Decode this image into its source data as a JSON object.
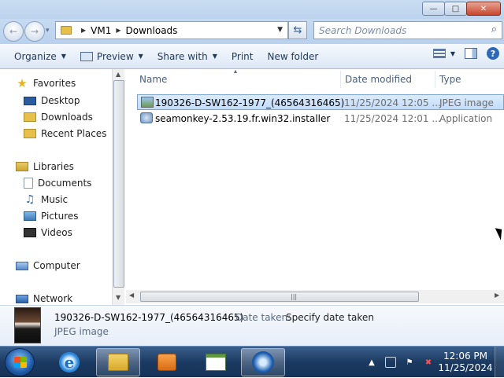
{
  "window": {
    "caption_buttons": [
      "minimize",
      "maximize",
      "close"
    ]
  },
  "address": {
    "crumbs": [
      "VM1",
      "Downloads"
    ],
    "search_placeholder": "Search Downloads"
  },
  "toolbar": {
    "organize": "Organize",
    "preview": "Preview",
    "share_with": "Share with",
    "print": "Print",
    "new_folder": "New folder"
  },
  "nav": {
    "favorites": "Favorites",
    "desktop": "Desktop",
    "downloads": "Downloads",
    "recent_places": "Recent Places",
    "libraries": "Libraries",
    "documents": "Documents",
    "music": "Music",
    "pictures": "Pictures",
    "videos": "Videos",
    "computer": "Computer",
    "network": "Network"
  },
  "columns": {
    "name": "Name",
    "date_modified": "Date modified",
    "type": "Type"
  },
  "files": [
    {
      "name": "190326-D-SW162-1977_(46564316465)",
      "date": "11/25/2024 12:05 ...",
      "type": "JPEG image",
      "icon": "jpeg-icon",
      "selected": true
    },
    {
      "name": "seamonkey-2.53.19.fr.win32.installer",
      "date": "11/25/2024 12:01 ...",
      "type": "Application",
      "icon": "installer-icon",
      "selected": false
    }
  ],
  "details": {
    "name": "190326-D-SW162-1977_(46564316465)",
    "date_label": "Date taken:",
    "date_value": "Specify date taken",
    "type": "JPEG image"
  },
  "taskbar": {
    "apps": [
      "internet-explorer",
      "windows-explorer",
      "media-player",
      "spreadsheet",
      "seamonkey"
    ],
    "time": "12:06 PM",
    "date": "11/25/2024"
  },
  "colors": {
    "selection": "#cce4ff",
    "taskbar": "#1c3a61",
    "accent": "#1e395b"
  }
}
